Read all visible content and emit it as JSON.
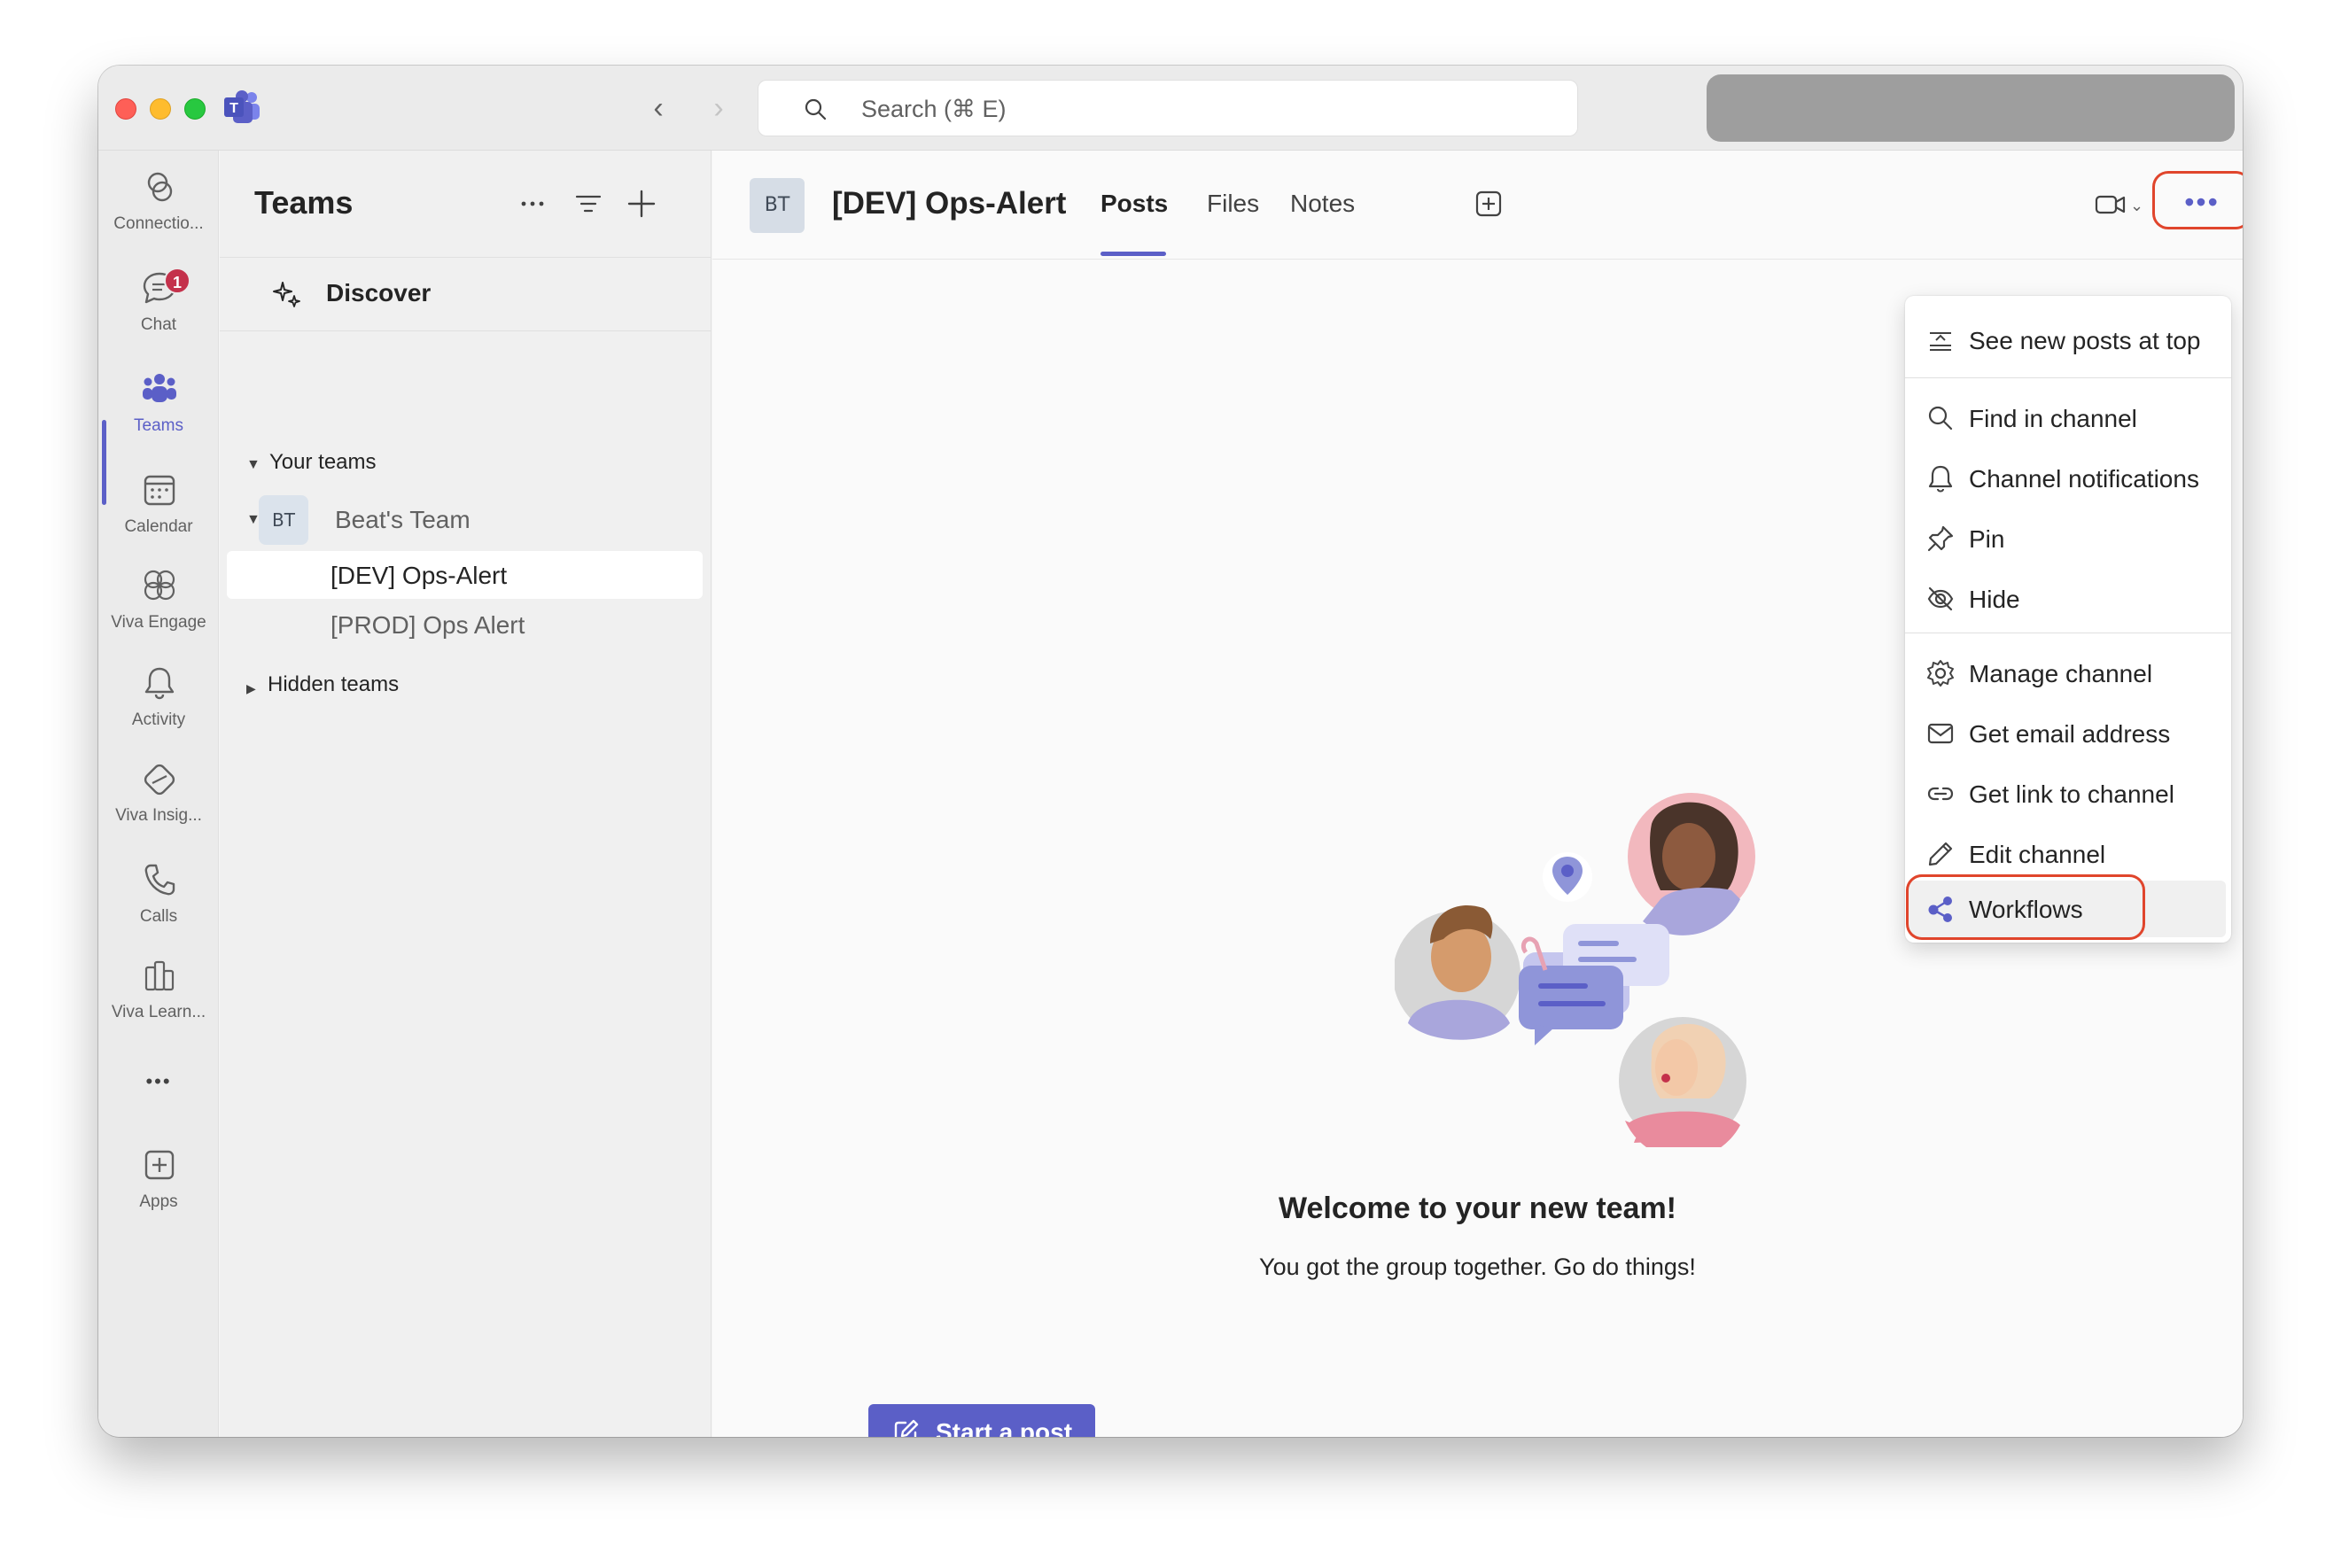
{
  "search": {
    "placeholder": "Search (⌘ E)"
  },
  "rail": {
    "items": [
      {
        "label": "Connectio...",
        "icon": "connections-icon"
      },
      {
        "label": "Chat",
        "icon": "chat-icon",
        "badge": "1"
      },
      {
        "label": "Teams",
        "icon": "teams-icon",
        "active": true
      },
      {
        "label": "Calendar",
        "icon": "calendar-icon"
      },
      {
        "label": "Viva Engage",
        "icon": "viva-engage-icon"
      },
      {
        "label": "Activity",
        "icon": "bell-icon"
      },
      {
        "label": "Viva Insig...",
        "icon": "viva-insights-icon"
      },
      {
        "label": "Calls",
        "icon": "phone-icon"
      },
      {
        "label": "Viva Learn...",
        "icon": "viva-learning-icon"
      },
      {
        "label": "Apps",
        "icon": "add-apps-icon"
      }
    ],
    "more_label": "•••"
  },
  "teams_pane": {
    "title": "Teams",
    "discover_label": "Discover",
    "your_teams_label": "Your teams",
    "team": {
      "avatar": "BT",
      "name": "Beat's Team"
    },
    "channels": [
      {
        "name": "[DEV] Ops-Alert",
        "selected": true
      },
      {
        "name": "[PROD] Ops Alert",
        "selected": false
      }
    ],
    "hidden_teams_label": "Hidden teams"
  },
  "channel_header": {
    "avatar": "BT",
    "title": "[DEV] Ops-Alert",
    "tabs": [
      {
        "label": "Posts",
        "active": true
      },
      {
        "label": "Files",
        "active": false
      },
      {
        "label": "Notes",
        "active": false
      }
    ],
    "more_label": "•••"
  },
  "welcome": {
    "title": "Welcome to your new team!",
    "subtitle": "You got the group together. Go do things!"
  },
  "start_post_label": "Start a post",
  "menu": {
    "items": [
      {
        "label": "See new posts at top",
        "icon": "sort-newest-icon"
      },
      {
        "label": "Find in channel",
        "icon": "search-icon"
      },
      {
        "label": "Channel notifications",
        "icon": "bell-icon"
      },
      {
        "label": "Pin",
        "icon": "pin-icon"
      },
      {
        "label": "Hide",
        "icon": "eye-off-icon"
      },
      {
        "label": "Manage channel",
        "icon": "gear-icon"
      },
      {
        "label": "Get email address",
        "icon": "mail-icon"
      },
      {
        "label": "Get link to channel",
        "icon": "link-icon"
      },
      {
        "label": "Edit channel",
        "icon": "pencil-icon"
      },
      {
        "label": "Workflows",
        "icon": "workflows-icon",
        "hovered": true
      }
    ]
  },
  "colors": {
    "accent": "#5b5fc7",
    "highlight_ring": "#e0452c",
    "badge": "#c4314b"
  }
}
